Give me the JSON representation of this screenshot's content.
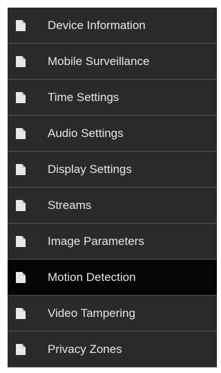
{
  "menu": {
    "items": [
      {
        "label": "Device Information",
        "icon": "document-icon",
        "active": false
      },
      {
        "label": "Mobile Surveillance",
        "icon": "document-icon",
        "active": false
      },
      {
        "label": "Time Settings",
        "icon": "document-icon",
        "active": false
      },
      {
        "label": "Audio Settings",
        "icon": "document-icon",
        "active": false
      },
      {
        "label": "Display Settings",
        "icon": "document-icon",
        "active": false
      },
      {
        "label": "Streams",
        "icon": "document-icon",
        "active": false
      },
      {
        "label": "Image Parameters",
        "icon": "document-icon",
        "active": false
      },
      {
        "label": "Motion Detection",
        "icon": "document-icon",
        "active": true
      },
      {
        "label": "Video Tampering",
        "icon": "document-icon",
        "active": false
      },
      {
        "label": "Privacy Zones",
        "icon": "document-icon",
        "active": false
      }
    ]
  },
  "colors": {
    "item_background": "#2a2a2a",
    "active_background": "#050505",
    "divider": "#575757",
    "text": "#e6e6e6",
    "icon": "#e8e8e8"
  }
}
